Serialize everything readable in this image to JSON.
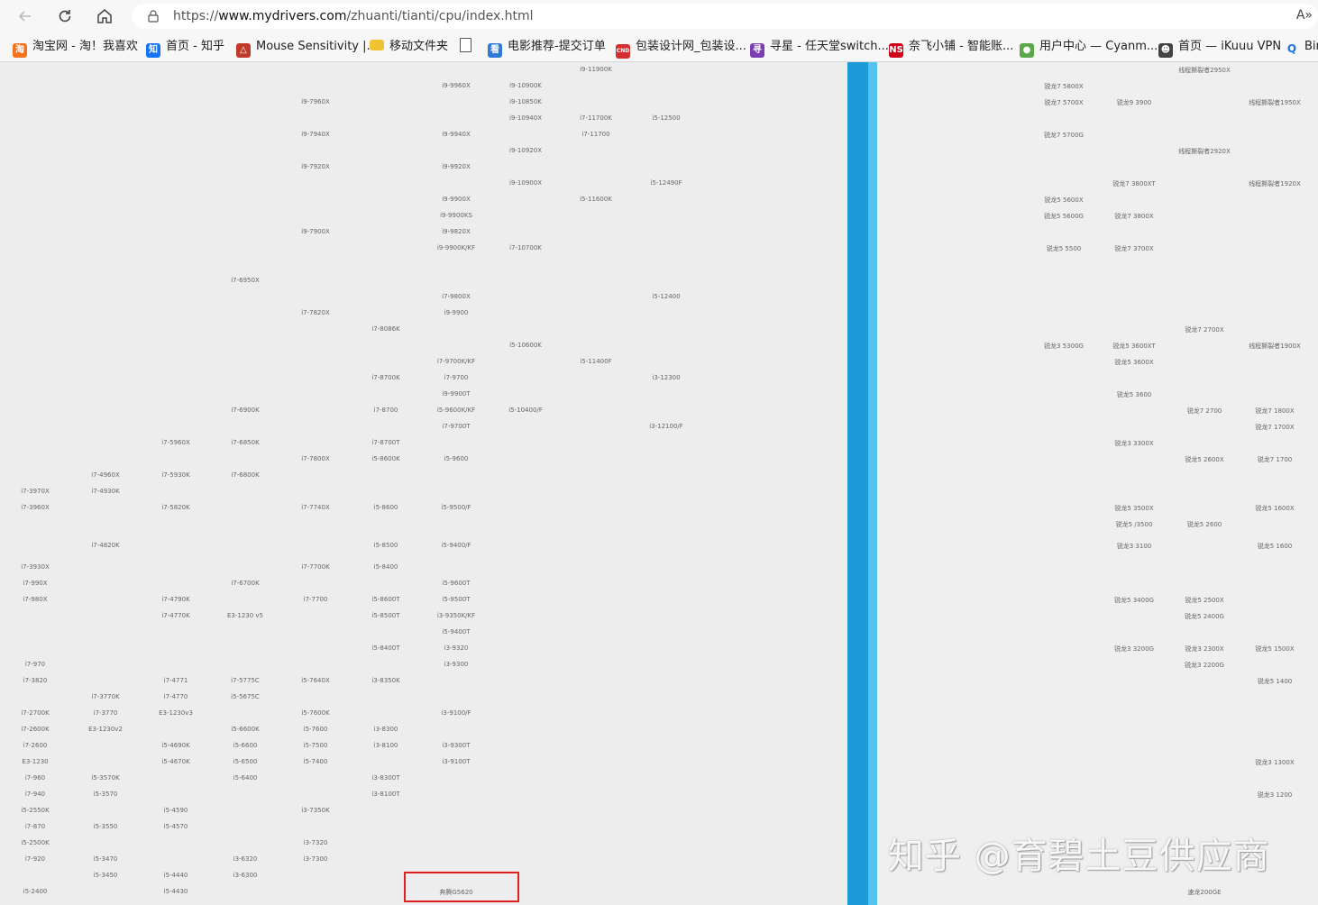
{
  "browser": {
    "url_prefix": "https://",
    "url_host": "www.mydrivers.com",
    "url_path": "/zhuanti/tianti/cpu/index.html",
    "read_aloud_icon": "A»"
  },
  "bookmarks": [
    {
      "label": "淘宝网 - 淘！我喜欢",
      "icon": "taobao-icon",
      "color": "#f47321",
      "glyph": "淘"
    },
    {
      "label": "首页 - 知乎",
      "icon": "zhihu-icon",
      "color": "#1772f6",
      "glyph": "知"
    },
    {
      "label": "Mouse Sensitivity |...",
      "icon": "mouse-sensitivity-icon",
      "color": "#c0392b",
      "glyph": "△"
    },
    {
      "label": "移动文件夹",
      "icon": "folder-icon",
      "color": "#f1c232",
      "glyph": ""
    },
    {
      "label": "",
      "icon": "page-icon",
      "color": "#ffffff",
      "glyph": ""
    },
    {
      "label": "电影推荐-提交订单",
      "icon": "movie-icon",
      "color": "#2f7ad8",
      "glyph": "看"
    },
    {
      "label": "包装设计网_包装设...",
      "icon": "cnd-icon",
      "color": "#d32f2f",
      "glyph": "CND"
    },
    {
      "label": "寻星 - 任天堂switch...",
      "icon": "xunxing-icon",
      "color": "#7b3fb3",
      "glyph": "寻"
    },
    {
      "label": "奈飞小铺 - 智能账...",
      "icon": "ns-icon",
      "color": "#d0021b",
      "glyph": "NS"
    },
    {
      "label": "用户中心 — Cyanm...",
      "icon": "user-center-icon",
      "color": "#5aa84a",
      "glyph": "●"
    },
    {
      "label": "首页 — iKuuu VPN",
      "icon": "ikuuu-icon",
      "color": "#444444",
      "glyph": "☻"
    },
    {
      "label": "Bin",
      "icon": "bing-search-icon",
      "color": "#1a73e8",
      "glyph": "Q"
    }
  ],
  "intel_cpus": [
    [
      "i9-11900K"
    ],
    [
      "i9-9960X",
      "i9-10900K"
    ],
    [
      "i9-7960X",
      "i9-10850K"
    ],
    [
      "i9-10940X",
      "i7-11700K",
      "i5-12500"
    ],
    [
      "i9-7940X",
      "i9-9940X",
      "i7-11700"
    ],
    [
      "i9-10920X"
    ],
    [
      "i9-7920X",
      "i9-9920X"
    ],
    [
      "i9-10900X",
      "i5-12490F"
    ],
    [
      "i9-9900X",
      "i5-11600K"
    ],
    [
      "i9-9900KS"
    ],
    [
      "i9-7900X",
      "i9-9820X"
    ],
    [
      "i9-9900K/KF",
      "i7-10700K"
    ],
    [
      "i7-6950X"
    ],
    [
      "i7-9800X",
      "i5-12400"
    ],
    [
      "i7-7820X",
      "i9-9900"
    ],
    [
      "i7-8086K"
    ],
    [
      "i5-10600K"
    ],
    [
      "i7-9700K/KF",
      "i5-11400F"
    ],
    [
      "i7-8700K",
      "i7-9700",
      "i3-12300"
    ],
    [
      "i9-9900T"
    ],
    [
      "i7-6900K",
      "i7-8700",
      "i5-9600K/KF",
      "i5-10400/F"
    ],
    [
      "i7-9700T",
      "i3-12100/F"
    ],
    [
      "i7-5960X",
      "i7-6850K",
      "i7-8700T"
    ],
    [
      "i7-7800X",
      "i5-8600K",
      "i5-9600"
    ],
    [
      "i7-4960X",
      "i7-5930K",
      "i7-6800K"
    ],
    [
      "i7-3970X",
      "i7-4930K"
    ],
    [
      "i7-3960X",
      "i7-5820K",
      "i7-7740X",
      "i5-8600",
      "i5-9500/F"
    ],
    [
      "i7-4820K",
      "i5-8500",
      "i5-9400/F"
    ],
    [
      "i7-3930X",
      "i7-7700K",
      "i5-8400"
    ],
    [
      "i7-990X",
      "i7-6700K",
      "i5-9600T"
    ],
    [
      "i7-980X",
      "i7-4790K",
      "i7-7700",
      "i5-8600T",
      "i5-9500T"
    ],
    [
      "i7-4770K",
      "E3-1230 v5",
      "i5-8500T",
      "i3-9350K/KF"
    ],
    [
      "i5-9400T"
    ],
    [
      "i5-8400T",
      "i3-9320"
    ],
    [
      "i7-970",
      "i3-9300"
    ],
    [
      "i7-3820",
      "i7-4771",
      "i7-5775C",
      "i5-7640X",
      "i3-8350K"
    ],
    [
      "i7-3770K",
      "i7-4770",
      "i5-5675C"
    ],
    [
      "i7-2700K",
      "i7-3770",
      "E3-1230v3",
      "i5-7600K",
      "i3-9100/F"
    ],
    [
      "i7-2600K",
      "E3-1230v2",
      "i5-6600K",
      "i5-7600",
      "i3-8300"
    ],
    [
      "i7-2600",
      "i5-4690K",
      "i5-6600",
      "i5-7500",
      "i3-8100",
      "i3-9300T"
    ],
    [
      "E3-1230",
      "i5-4670K",
      "i5-6500",
      "i5-7400",
      "i3-9100T"
    ],
    [
      "i7-960",
      "i5-3570K",
      "i5-6400",
      "i3-8300T"
    ],
    [
      "i7-940",
      "i5-3570",
      "i3-8100T"
    ],
    [
      "i5-2550K",
      "i5-4590",
      "i3-7350K"
    ],
    [
      "i7-870",
      "i5-3550",
      "i5-4570"
    ],
    [
      "i5-2500K",
      "i3-7320"
    ],
    [
      "i7-920",
      "i5-3470",
      "i3-6320",
      "i3-7300"
    ],
    [
      "i5-3450",
      "i5-4440",
      "i3-6300"
    ],
    [
      "i5-2400",
      "i5-4430",
      "奔腾G5620"
    ]
  ],
  "amd_cpus": [
    [
      "线程撕裂者2950X"
    ],
    [
      "锐龙7 5800X"
    ],
    [
      "锐龙7 5700X",
      "锐龙9 3900",
      "线程撕裂者1950X"
    ],
    [
      "锐龙7 5700G"
    ],
    [
      "线程撕裂者2920X"
    ],
    [
      "锐龙7 3800XT",
      "线程撕裂者1920X"
    ],
    [
      "锐龙5 5600X"
    ],
    [
      "锐龙5 5600G",
      "锐龙7 3800X"
    ],
    [
      "锐龙5 5500",
      "锐龙7 3700X"
    ],
    [
      "锐龙7 2700X"
    ],
    [
      "锐龙3 5300G",
      "锐龙5 3600XT",
      "线程撕裂者1900X"
    ],
    [
      "锐龙5 3600X"
    ],
    [
      "锐龙5 3600"
    ],
    [
      "锐龙7 2700",
      "锐龙7 1800X"
    ],
    [
      "锐龙7 1700X"
    ],
    [
      "锐龙3 3300X"
    ],
    [
      "锐龙5 2600X",
      "锐龙7 1700"
    ],
    [
      "锐龙5 3500X",
      "锐龙5 1600X"
    ],
    [
      "锐龙5 /3500",
      "锐龙5 2600"
    ],
    [
      "锐龙3 3100",
      "锐龙5 1600"
    ],
    [
      "锐龙5 3400G",
      "锐龙5 2500X"
    ],
    [
      "锐龙5 2400G"
    ],
    [
      "锐龙3 3200G",
      "锐龙3 2300X",
      "锐龙5 1500X"
    ],
    [
      "锐龙3 2200G"
    ],
    [
      "锐龙5 1400"
    ],
    [
      "锐龙3 1300X"
    ],
    [
      "锐龙3 1200"
    ],
    [
      "速龙200GE"
    ]
  ],
  "highlight_label": "奔腾G5620",
  "watermark": "知乎 @育碧土豆供应商"
}
